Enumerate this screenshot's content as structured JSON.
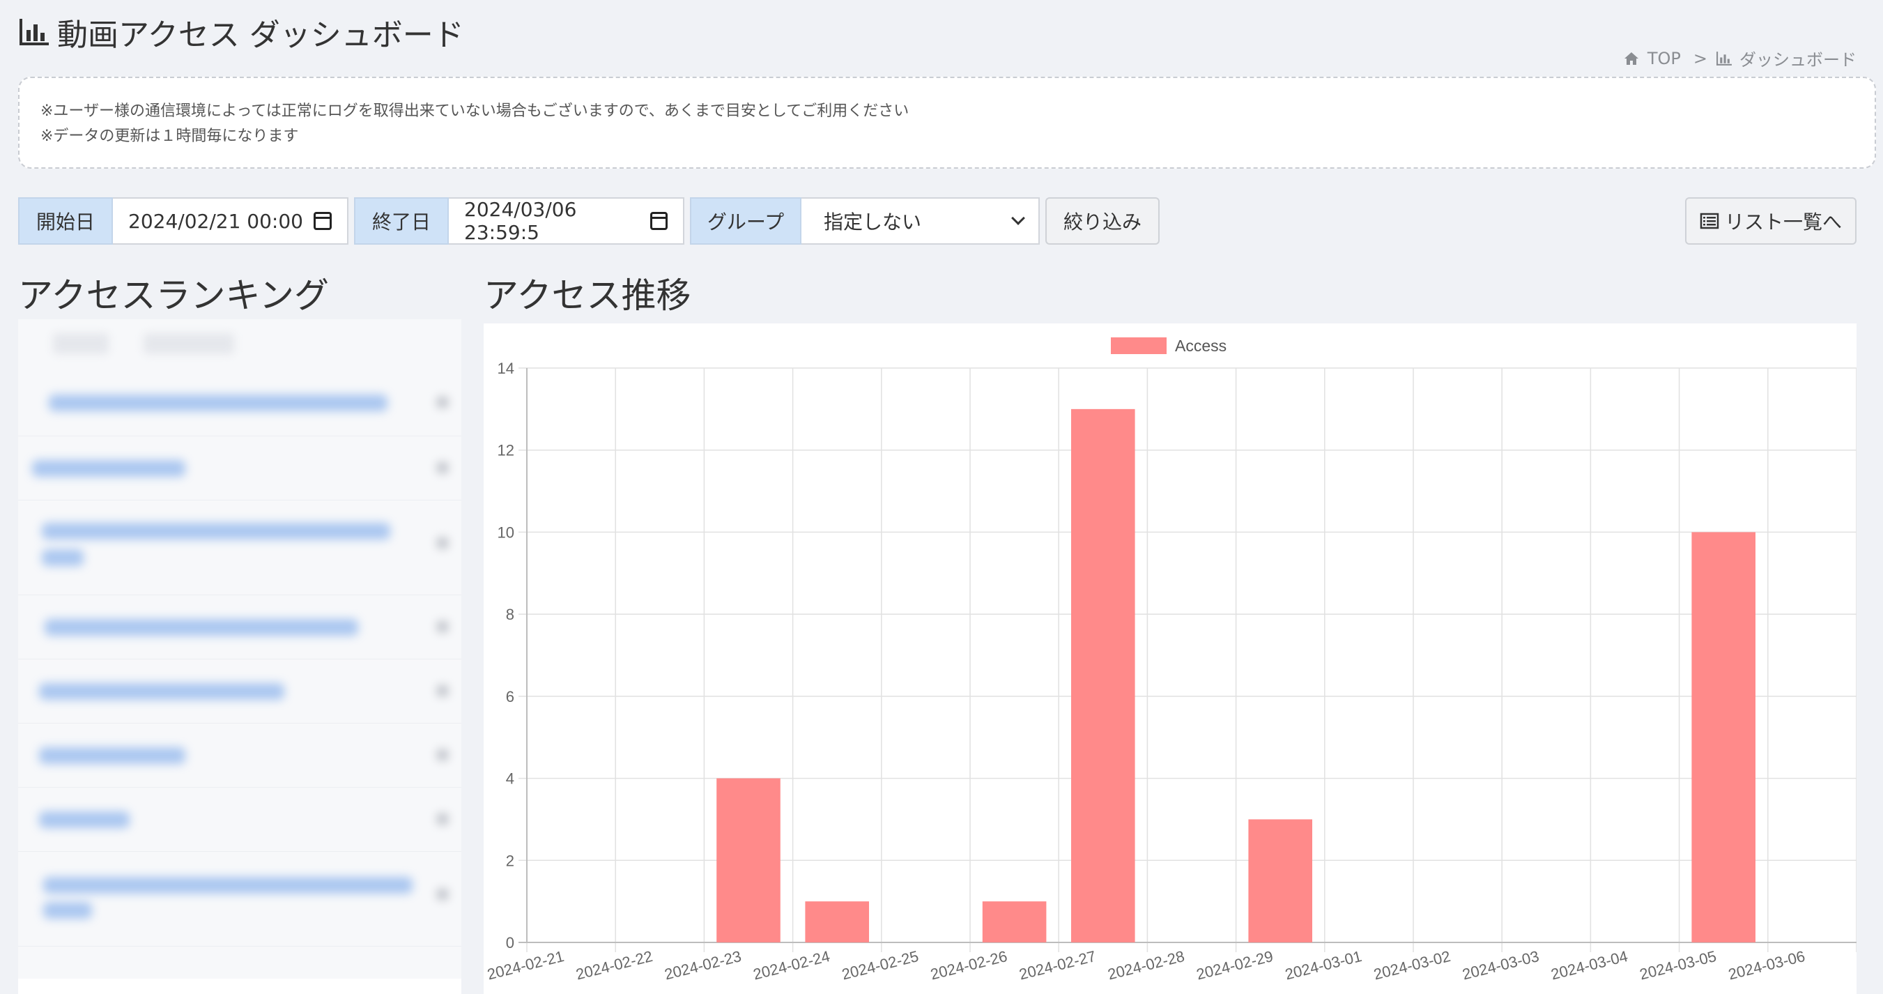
{
  "page": {
    "title": "動画アクセス ダッシュボード",
    "title_icon": "bar-chart-icon"
  },
  "breadcrumb": {
    "home": "TOP",
    "separator": ">",
    "current": "ダッシュボード"
  },
  "notice": {
    "lines": [
      "※ユーザー様の通信環境によっては正常にログを取得出来ていない場合もございますので、あくまで目安としてご利用ください",
      "※データの更新は１時間毎になります"
    ]
  },
  "filters": {
    "start_label": "開始日",
    "start_value": "2024/02/21 00:00",
    "end_label": "終了日",
    "end_value": "2024/03/06 23:59:5",
    "group_label": "グループ",
    "group_value": "指定しない",
    "submit_label": "絞り込み"
  },
  "list_button": {
    "label": "リスト一覧へ",
    "icon": "list-icon"
  },
  "ranking": {
    "title": "アクセスランキング"
  },
  "trend": {
    "title": "アクセス推移"
  },
  "colors": {
    "bar": "#ff8a8a",
    "addon_bg": "#cfe2f7",
    "page_bg": "#f0f2f6"
  },
  "chart_data": {
    "type": "bar",
    "categories": [
      "2024-02-21",
      "2024-02-22",
      "2024-02-23",
      "2024-02-24",
      "2024-02-25",
      "2024-02-26",
      "2024-02-27",
      "2024-02-28",
      "2024-02-29",
      "2024-03-01",
      "2024-03-02",
      "2024-03-03",
      "2024-03-04",
      "2024-03-05",
      "2024-03-06"
    ],
    "series": [
      {
        "name": "Access",
        "values": [
          0,
          0,
          4,
          1,
          0,
          1,
          13,
          0,
          3,
          0,
          0,
          0,
          0,
          10,
          0
        ]
      }
    ],
    "ylim": [
      0,
      14
    ],
    "yticks": [
      0,
      2,
      4,
      6,
      8,
      10,
      12,
      14
    ],
    "grid": true,
    "legend": "top-center"
  }
}
